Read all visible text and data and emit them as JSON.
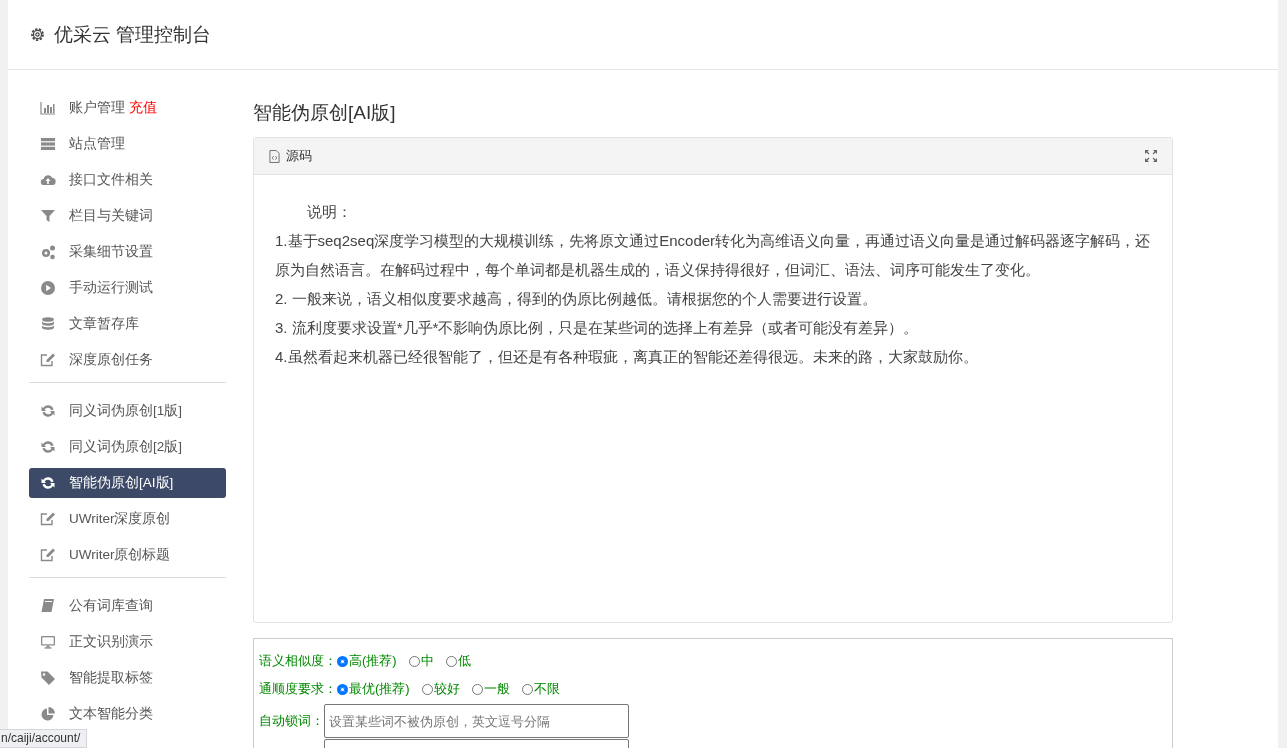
{
  "header": {
    "title": "优采云 管理控制台"
  },
  "sidebar": {
    "groups": [
      [
        {
          "label": "账户管理",
          "badge": "充值",
          "selected": false
        },
        {
          "label": "站点管理",
          "selected": false
        },
        {
          "label": "接口文件相关",
          "selected": false
        },
        {
          "label": "栏目与关键词",
          "selected": false
        },
        {
          "label": "采集细节设置",
          "selected": false
        },
        {
          "label": "手动运行测试",
          "selected": false
        },
        {
          "label": "文章暂存库",
          "selected": false
        },
        {
          "label": "深度原创任务",
          "selected": false
        }
      ],
      [
        {
          "label": "同义词伪原创[1版]",
          "selected": false
        },
        {
          "label": "同义词伪原创[2版]",
          "selected": false
        },
        {
          "label": "智能伪原创[AI版]",
          "selected": true
        },
        {
          "label": "UWriter深度原创",
          "selected": false
        },
        {
          "label": "UWriter原创标题",
          "selected": false
        }
      ],
      [
        {
          "label": "公有词库查询",
          "selected": false
        },
        {
          "label": "正文识别演示",
          "selected": false
        },
        {
          "label": "智能提取标签",
          "selected": false
        },
        {
          "label": "文本智能分类",
          "selected": false
        }
      ]
    ]
  },
  "page": {
    "title": "智能伪原创[AI版]",
    "source_panel": {
      "tab": "源码",
      "heading": "说明：",
      "paragraphs": [
        "1.基于seq2seq深度学习模型的大规模训练，先将原文通过Encoder转化为高维语义向量，再通过语义向量是通过解码器逐字解码，还原为自然语言。在解码过程中，每个单词都是机器生成的，语义保持得很好，但词汇、语法、词序可能发生了变化。",
        "2. 一般来说，语义相似度要求越高，得到的伪原比例越低。请根据您的个人需要进行设置。",
        "3. 流利度要求设置*几乎*不影响伪原比例，只是在某些词的选择上有差异（或者可能没有差异）。",
        "4.虽然看起来机器已经很智能了，但还是有各种瑕疵，离真正的智能还差得很远。未来的路，大家鼓励你。"
      ]
    },
    "form": {
      "rows": [
        {
          "kind": "radio",
          "label": "语义相似度：",
          "options": [
            {
              "label": "高(推荐)",
              "selected": true
            },
            {
              "label": "中",
              "selected": false
            },
            {
              "label": "低",
              "selected": false
            }
          ]
        },
        {
          "kind": "radio",
          "label": "通顺度要求：",
          "options": [
            {
              "label": "最优(推荐)",
              "selected": true
            },
            {
              "label": "较好",
              "selected": false
            },
            {
              "label": "一般",
              "selected": false
            },
            {
              "label": "不限",
              "selected": false
            }
          ]
        },
        {
          "kind": "text",
          "label": "自动锁词：",
          "placeholder": "设置某些词不被伪原创，英文逗号分隔"
        }
      ]
    }
  },
  "status_url": "n/caiji/account/"
}
